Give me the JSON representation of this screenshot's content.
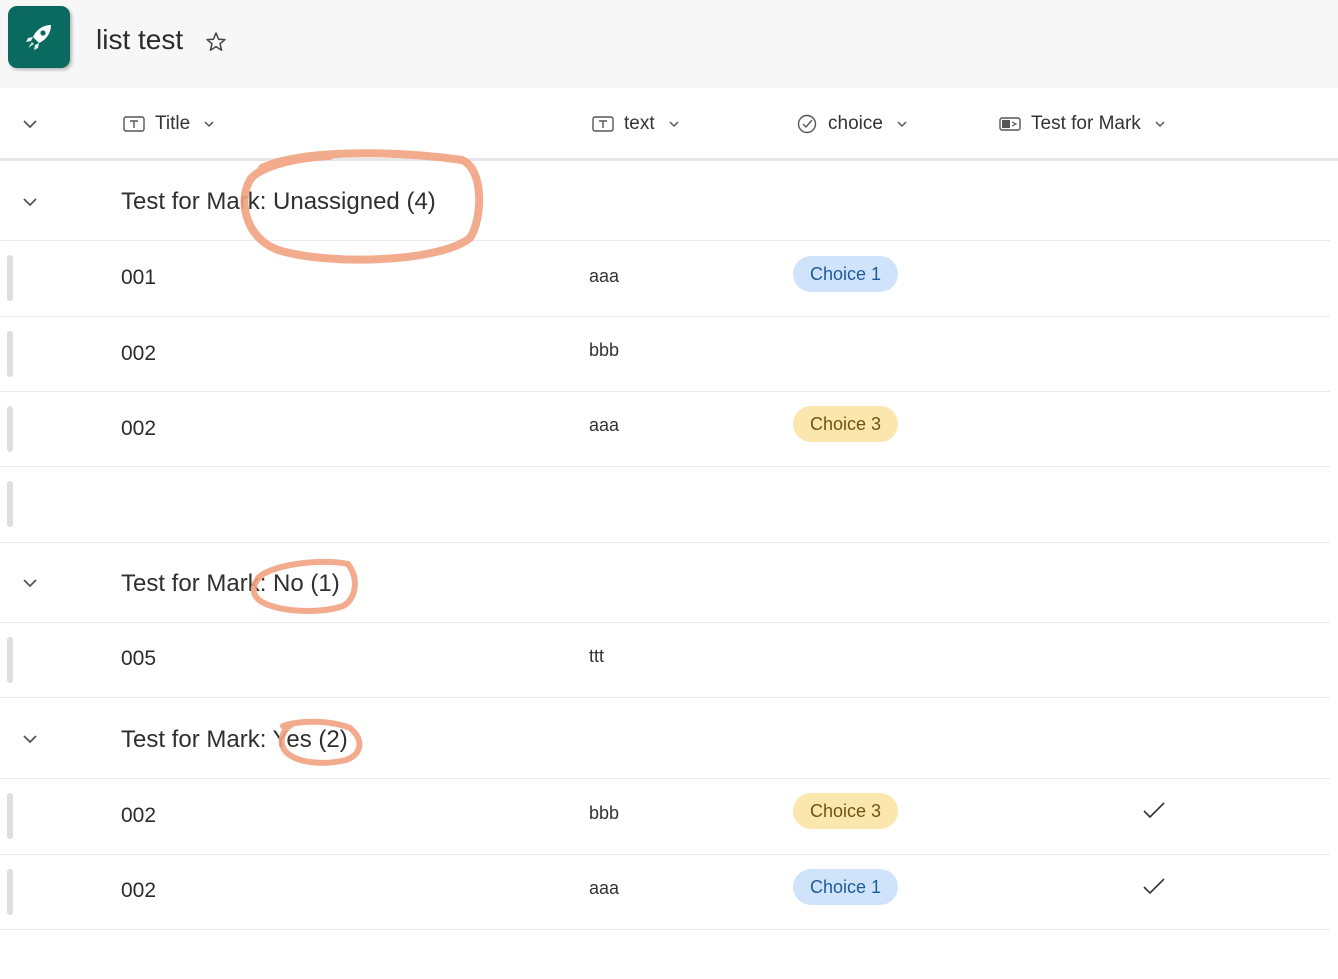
{
  "header": {
    "title": "list test"
  },
  "columns": [
    {
      "label": "Title",
      "icon": "text-field-icon"
    },
    {
      "label": "text",
      "icon": "text-field-icon"
    },
    {
      "label": "choice",
      "icon": "choice-icon"
    },
    {
      "label": "Test for Mark",
      "icon": "yes-no-icon"
    }
  ],
  "groups": [
    {
      "label": "Test for Mark: Unassigned (4)",
      "rows": [
        {
          "title": "001",
          "text": "aaa",
          "choice": "Choice 1",
          "mark": ""
        },
        {
          "title": "002",
          "text": "bbb",
          "choice": "",
          "mark": ""
        },
        {
          "title": "002",
          "text": "aaa",
          "choice": "Choice 3",
          "mark": ""
        },
        {
          "title": "",
          "text": "",
          "choice": "",
          "mark": ""
        }
      ]
    },
    {
      "label": "Test for Mark: No (1)",
      "rows": [
        {
          "title": "005",
          "text": "ttt",
          "choice": "",
          "mark": ""
        }
      ]
    },
    {
      "label": "Test for Mark: Yes (2)",
      "rows": [
        {
          "title": "002",
          "text": "bbb",
          "choice": "Choice 3",
          "mark": "check"
        },
        {
          "title": "002",
          "text": "aaa",
          "choice": "Choice 1",
          "mark": "check"
        }
      ]
    }
  ],
  "colors": {
    "brand": "#0b6a5f",
    "choice_1_bg": "#cfe4fa",
    "choice_3_bg": "#fbe7ad",
    "annotation": "#f2a282"
  }
}
